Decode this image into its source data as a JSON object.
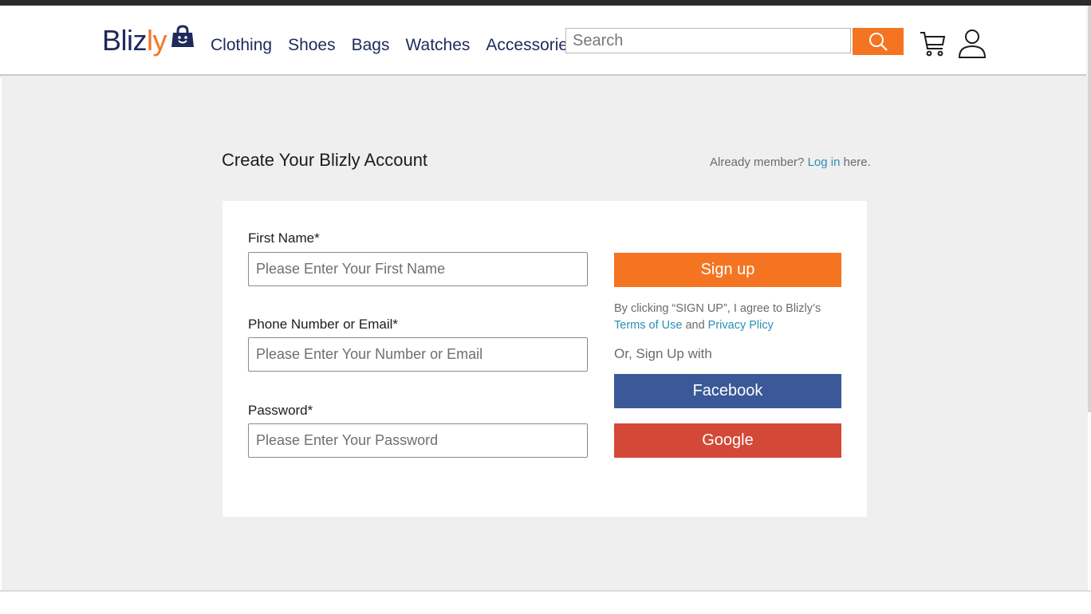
{
  "header": {
    "logo_part1": "Bliz",
    "logo_part2": "ly",
    "nav": [
      "Clothing",
      "Shoes",
      "Bags",
      "Watches",
      "Accessories"
    ],
    "search_placeholder": "Search"
  },
  "page": {
    "title": "Create Your Blizly Account",
    "already_prefix": "Already member? ",
    "login_link": "Log in",
    "already_suffix": " here."
  },
  "form": {
    "first_name_label": "First Name*",
    "first_name_placeholder": "Please Enter Your First Name",
    "contact_label": "Phone Number or Email*",
    "contact_placeholder": "Please Enter Your Number or Email",
    "password_label": "Password*",
    "password_placeholder": "Please Enter Your Password"
  },
  "actions": {
    "signup_label": "Sign up",
    "terms_prefix": "By clicking “SIGN UP”, I agree to Blizly’s",
    "terms_link": "Terms of Use",
    "and_text": " and ",
    "privacy_link": "Privacy Plicy",
    "or_text": "Or, Sign Up with",
    "facebook_label": "Facebook",
    "google_label": "Google"
  },
  "icons": {
    "bag": "shopping-bag-icon",
    "search": "search-icon",
    "cart": "cart-icon",
    "user": "user-icon"
  },
  "colors": {
    "brand_navy": "#1d2a5b",
    "brand_orange": "#f47421",
    "facebook": "#3b5998",
    "google": "#d34836",
    "link": "#2a8fb5"
  }
}
